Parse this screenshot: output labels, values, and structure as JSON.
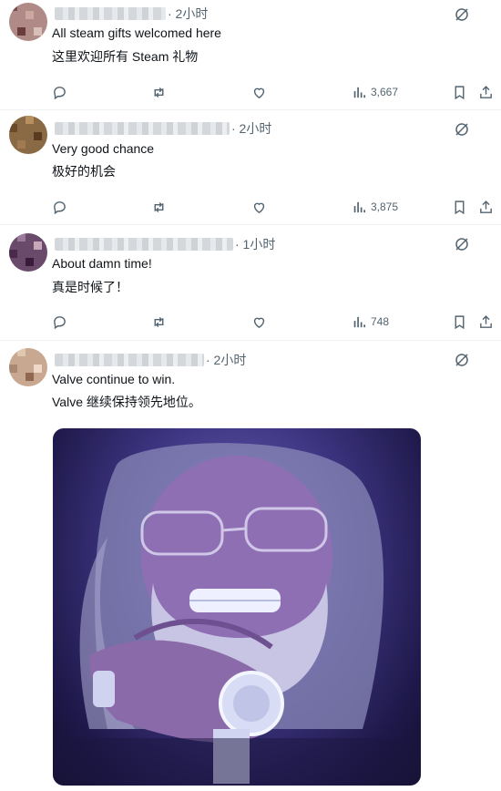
{
  "replies": [
    {
      "time": "· 2小时",
      "text_en": "All steam gifts welcomed here",
      "text_zh": "这里欢迎所有 Steam 礼物",
      "views": "3,667"
    },
    {
      "time": "· 2小时",
      "text_en": "Very good chance",
      "text_zh": "极好的机会",
      "views": "3,875"
    },
    {
      "time": "· 1小时",
      "text_en": "About damn time!",
      "text_zh": "真是时候了！",
      "views": "748"
    },
    {
      "time": "· 2小时",
      "text_en": "Valve continue to win.",
      "text_zh": "Valve 继续保持领先地位。"
    }
  ],
  "colors": {
    "text": "#0f1419",
    "secondary": "#536471",
    "divider": "#eff3f4"
  },
  "icons": [
    "grok-icon",
    "reply-icon",
    "repost-icon",
    "like-icon",
    "views-icon",
    "bookmark-icon",
    "share-icon"
  ]
}
